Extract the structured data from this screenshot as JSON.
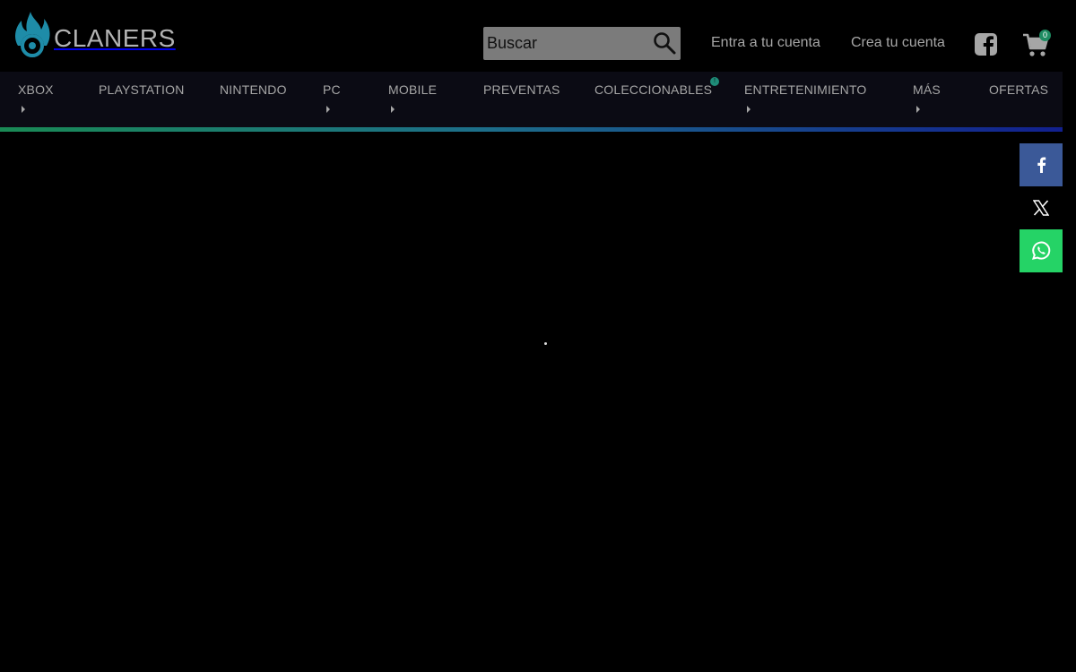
{
  "brand": {
    "name": "CLANERS",
    "accent": "#1e8ca8"
  },
  "search": {
    "placeholder": "Buscar"
  },
  "account": {
    "login_label": "Entra a tu cuenta",
    "register_label": "Crea tu cuenta"
  },
  "cart": {
    "count": "0"
  },
  "nav": {
    "items": [
      {
        "label": "XBOX",
        "has_submenu": true
      },
      {
        "label": "PLAYSTATION",
        "has_submenu": false
      },
      {
        "label": "NINTENDO",
        "has_submenu": false
      },
      {
        "label": "PC",
        "has_submenu": true
      },
      {
        "label": "MOBILE",
        "has_submenu": true
      },
      {
        "label": "PREVENTAS",
        "has_submenu": false
      },
      {
        "label": "COLECCIONABLES",
        "has_submenu": false,
        "badge": "!"
      },
      {
        "label": "ENTRETENIMIENTO",
        "has_submenu": true
      },
      {
        "label": "MÁS",
        "has_submenu": true
      },
      {
        "label": "OFERTAS",
        "has_submenu": false
      }
    ]
  },
  "share": {
    "icons": [
      "facebook-icon",
      "x-icon",
      "whatsapp-icon"
    ]
  },
  "colors": {
    "background": "#000000",
    "nav_bg": "#0b0b14",
    "facebook": "#3b5998",
    "whatsapp": "#25d366",
    "badge": "#1e8c62"
  }
}
